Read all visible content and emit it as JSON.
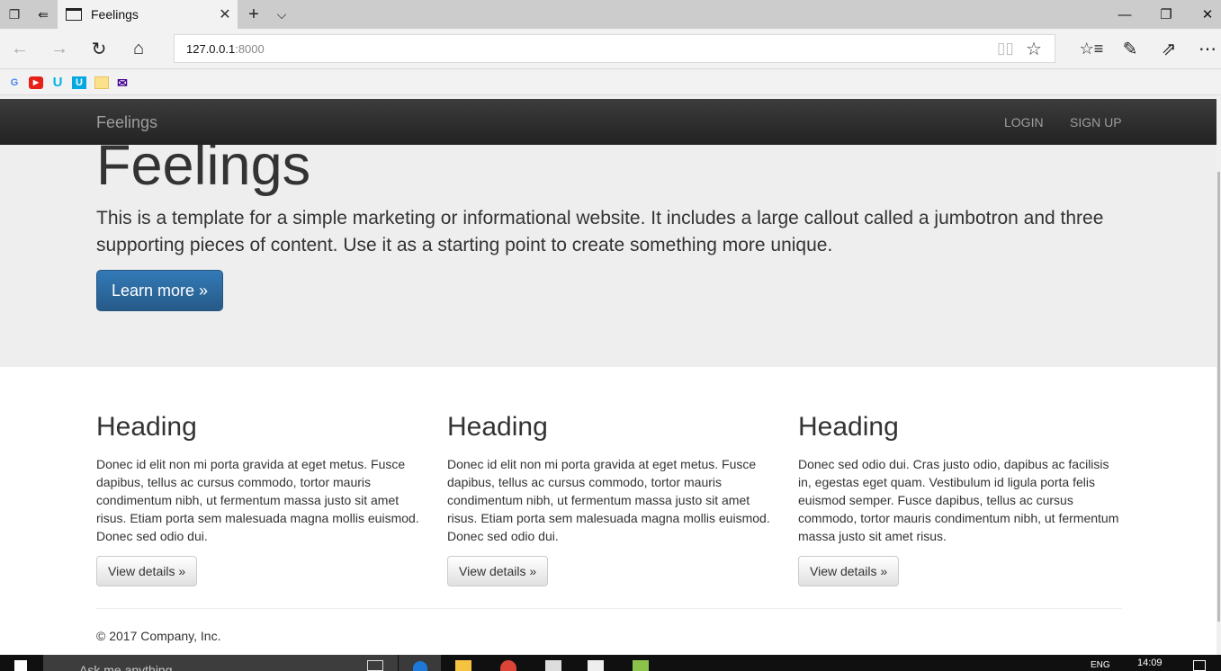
{
  "browser": {
    "tab_title": "Feelings",
    "url_host": "127.0.0.1",
    "url_port": ":8000",
    "bookmarks": [
      "G",
      "▶",
      "U",
      "U",
      "",
      "✉"
    ],
    "icons": [
      "tab-preview-icon",
      "set-aside-icon",
      "new-tab-icon",
      "tab-list-icon",
      "back-icon",
      "forward-icon",
      "refresh-icon",
      "home-icon",
      "reading-view-icon",
      "favorite-star-icon",
      "favorites-hub-icon",
      "web-note-icon",
      "share-icon",
      "more-icon"
    ]
  },
  "navbar": {
    "brand": "Feelings",
    "links": [
      "LOGIN",
      "SIGN UP"
    ]
  },
  "jumbotron": {
    "title": "Feelings",
    "text": "This is a template for a simple marketing or informational website. It includes a large callout called a jumbotron and three supporting pieces of content. Use it as a starting point to create something more unique.",
    "button": "Learn more »",
    "accent": "#337ab7"
  },
  "columns": [
    {
      "heading": "Heading",
      "text": "Donec id elit non mi porta gravida at eget metus. Fusce dapibus, tellus ac cursus commodo, tortor mauris condimentum nibh, ut fermentum massa justo sit amet risus. Etiam porta sem malesuada magna mollis euismod. Donec sed odio dui.",
      "button": "View details »"
    },
    {
      "heading": "Heading",
      "text": "Donec id elit non mi porta gravida at eget metus. Fusce dapibus, tellus ac cursus commodo, tortor mauris condimentum nibh, ut fermentum massa justo sit amet risus. Etiam porta sem malesuada magna mollis euismod. Donec sed odio dui.",
      "button": "View details »"
    },
    {
      "heading": "Heading",
      "text": "Donec sed odio dui. Cras justo odio, dapibus ac facilisis in, egestas eget quam. Vestibulum id ligula porta felis euismod semper. Fusce dapibus, tellus ac cursus commodo, tortor mauris condimentum nibh, ut fermentum massa justo sit amet risus.",
      "button": "View details »"
    }
  ],
  "footer": "© 2017 Company, Inc.",
  "taskbar": {
    "search_placeholder": "Ask me anything",
    "lang": "ENG",
    "time": "14:09"
  }
}
